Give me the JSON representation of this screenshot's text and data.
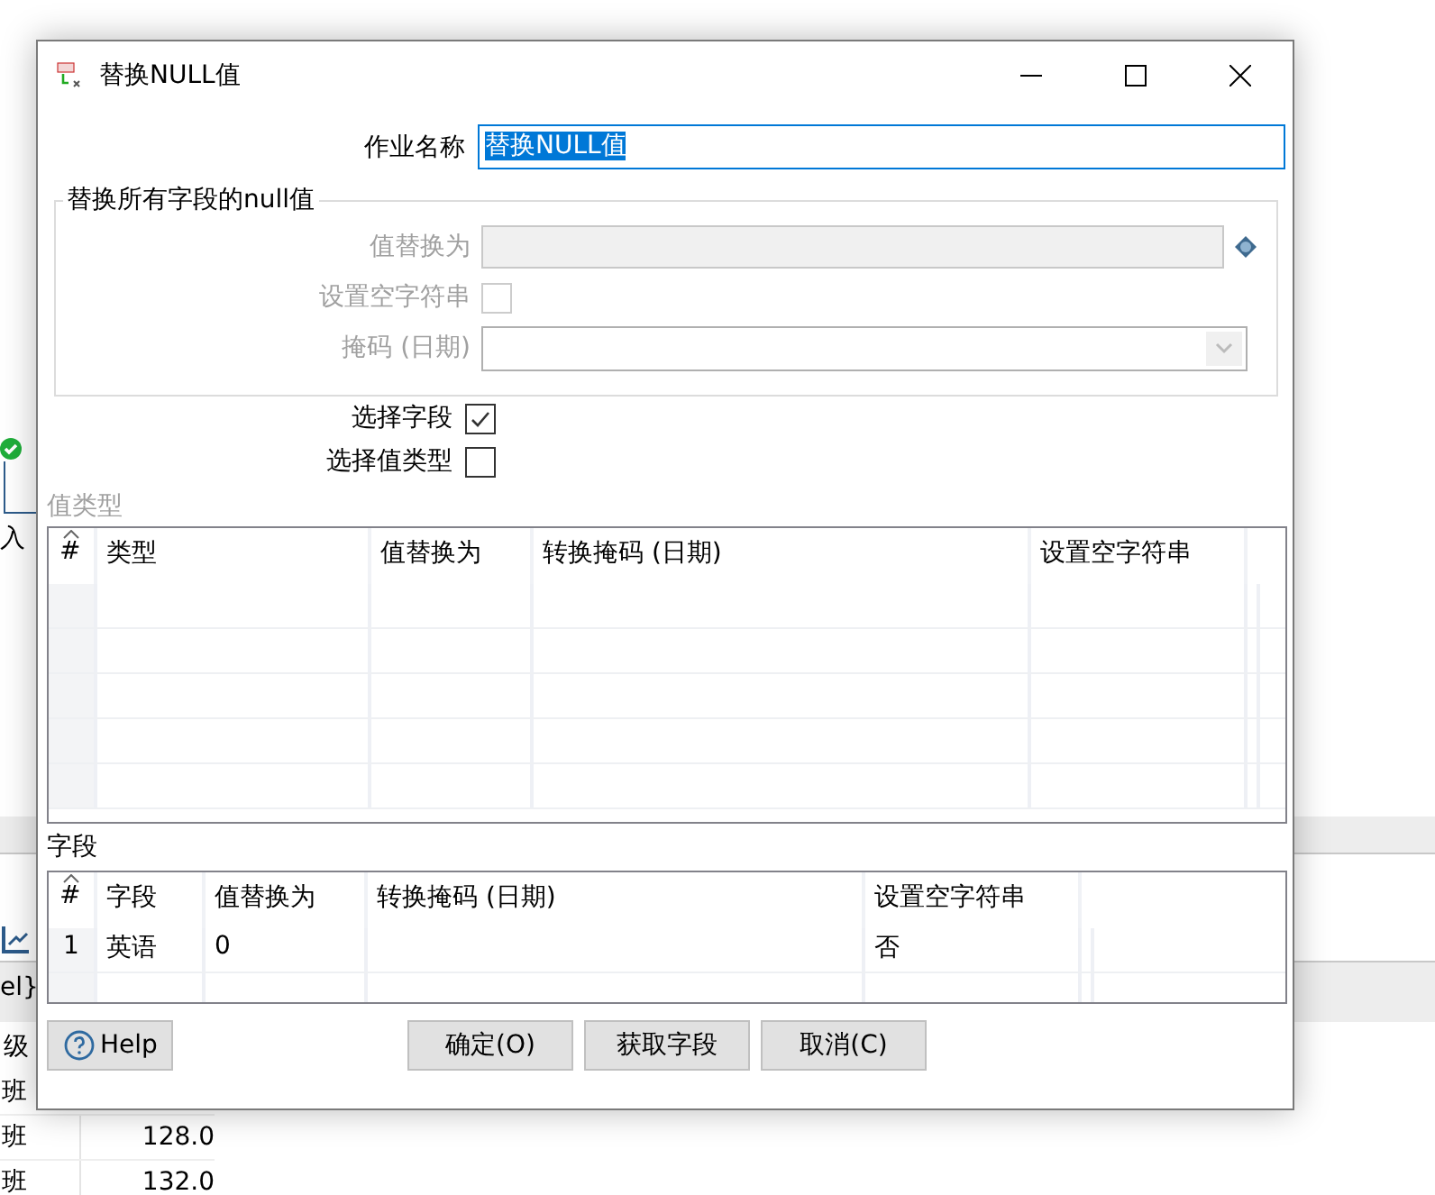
{
  "background_app": {
    "node_label": "入",
    "tab_label": "el}",
    "column_header": "级",
    "rows": [
      {
        "class": "班"
      },
      {
        "class": "班",
        "score": "128.0"
      },
      {
        "class": "班",
        "score": "132.0"
      }
    ]
  },
  "window": {
    "title": "替换NULL值"
  },
  "job_name": {
    "label": "作业名称",
    "value": "替换NULL值",
    "text_selected": true
  },
  "replace_all_group": {
    "title": "替换所有字段的null值",
    "replace_with": {
      "label": "值替换为",
      "disabled": true
    },
    "set_empty_string": {
      "label": "设置空字符串",
      "checked": false,
      "disabled": true
    },
    "mask": {
      "label": "掩码 (日期)",
      "disabled": true
    }
  },
  "select_fields": {
    "label": "选择字段",
    "checked": true
  },
  "select_value_types": {
    "label": "选择值类型",
    "checked": false
  },
  "value_types": {
    "title": "值类型",
    "disabled": true,
    "columns": [
      "#",
      "类型",
      "值替换为",
      "转换掩码 (日期)",
      "设置空字符串"
    ]
  },
  "fields": {
    "title": "字段",
    "columns": [
      "#",
      "字段",
      "值替换为",
      "转换掩码 (日期)",
      "设置空字符串"
    ],
    "rows": [
      {
        "num": "1",
        "field": "英语",
        "replace_with": "0",
        "set_empty_string": "否"
      }
    ]
  },
  "buttons": [
    {
      "label": "Help",
      "kind": "help"
    },
    {
      "label": "确定(O)",
      "kind": "plain"
    },
    {
      "label": "获取字段",
      "kind": "plain"
    },
    {
      "label": "取消(C)",
      "kind": "plain"
    }
  ]
}
